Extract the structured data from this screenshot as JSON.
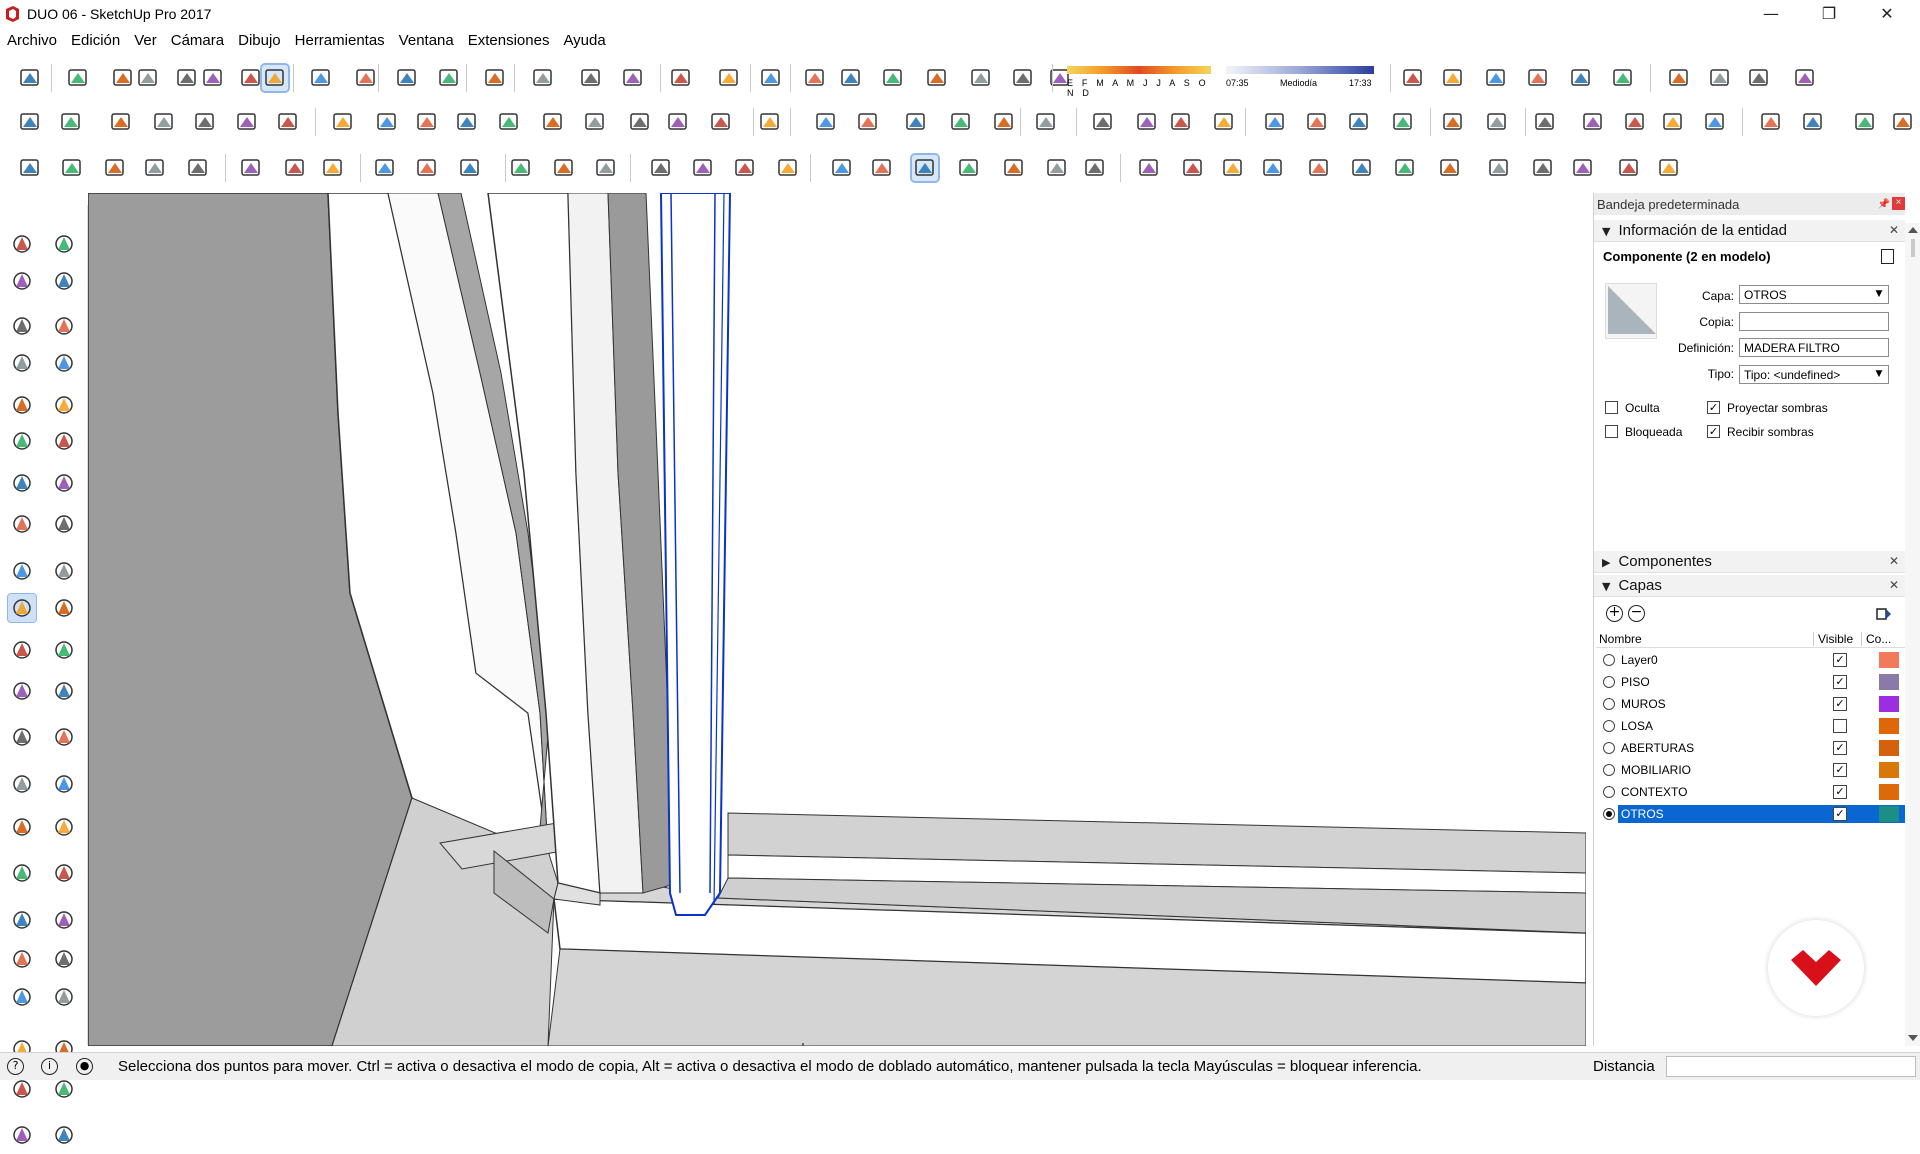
{
  "window": {
    "title": "DUO 06 - SketchUp Pro 2017",
    "minimize": "—",
    "maximize": "❐",
    "close": "✕"
  },
  "menu": [
    "Archivo",
    "Edición",
    "Ver",
    "Cámara",
    "Dibujo",
    "Herramientas",
    "Ventana",
    "Extensiones",
    "Ayuda"
  ],
  "shadows": {
    "months": "E F M A M J J A S O N D",
    "time_start": "07:35",
    "time_mid": "Mediodía",
    "time_end": "17:33"
  },
  "tray": {
    "title": "Bandeja predeterminada",
    "entity": {
      "header": "Información de la entidad",
      "title": "Componente (2 en modelo)",
      "layer_label": "Capa:",
      "layer_value": "OTROS",
      "instance_label": "Copia:",
      "instance_value": "",
      "definition_label": "Definición:",
      "definition_value": "MADERA FILTRO",
      "type_label": "Tipo:",
      "type_value": "Tipo: <undefined>",
      "hidden_label": "Oculta",
      "hidden": false,
      "locked_label": "Bloqueada",
      "locked": false,
      "cast_label": "Proyectar sombras",
      "cast": true,
      "receive_label": "Recibir sombras",
      "receive": true
    },
    "components_header": "Componentes",
    "layers": {
      "header": "Capas",
      "col_name": "Nombre",
      "col_visible": "Visible",
      "col_color": "Co...",
      "rows": [
        {
          "name": "Layer0",
          "visible": true,
          "active": false,
          "color": "#f07a5a"
        },
        {
          "name": "PISO",
          "visible": true,
          "active": false,
          "color": "#8a7aa8"
        },
        {
          "name": "MUROS",
          "visible": true,
          "active": false,
          "color": "#9a2ee0"
        },
        {
          "name": "LOSA",
          "visible": false,
          "active": false,
          "color": "#e0660a"
        },
        {
          "name": "ABERTURAS",
          "visible": true,
          "active": false,
          "color": "#d4620c"
        },
        {
          "name": "MOBILIARIO",
          "visible": true,
          "active": false,
          "color": "#d8780c"
        },
        {
          "name": "CONTEXTO",
          "visible": true,
          "active": false,
          "color": "#dc6a08"
        },
        {
          "name": "OTROS",
          "visible": true,
          "active": true,
          "color": "#1d8e86"
        }
      ]
    }
  },
  "status": {
    "message": "Selecciona dos puntos para mover. Ctrl = activa o desactiva el modo de copia, Alt = activa o desactiva el modo de doblado automático, mantener pulsada la tecla Mayúsculas = bloquear inferencia.",
    "measure_label": "Distancia",
    "measure_value": ""
  },
  "colors": {
    "selection": "#0a66d0",
    "brand": "#d8101a",
    "viewport_gray": "#9c9c9c"
  }
}
